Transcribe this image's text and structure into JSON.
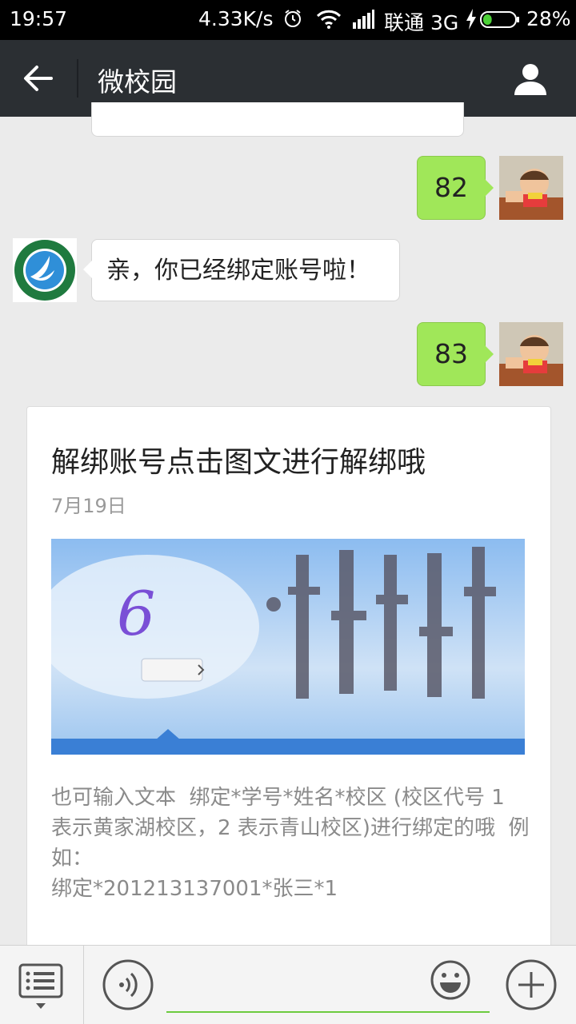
{
  "status_bar": {
    "time": "19:57",
    "net_speed": "4.33K/s",
    "carrier": "联通 3G",
    "battery": "28%",
    "battery_level": 0.28
  },
  "title_bar": {
    "title": "微校园",
    "icons": [
      "back-arrow-icon",
      "profile-icon"
    ]
  },
  "messages": [
    {
      "side": "right",
      "text": "82"
    },
    {
      "side": "left",
      "text": "亲，你已经绑定账号啦！"
    },
    {
      "side": "right",
      "text": "83"
    }
  ],
  "article": {
    "title": "解绑账号点击图文进行解绑哦",
    "date": "7月19日",
    "description": "也可输入文本  绑定*学号*姓名*校区 (校区代号 1 表示黄家湖校区，2 表示青山校区)进行绑定的哦  例如：\n绑定*201213137001*张三*1"
  },
  "input_bar": {
    "placeholder": "",
    "icons": [
      "menu-list-icon",
      "voice-icon",
      "emoji-icon",
      "plus-icon"
    ]
  },
  "colors": {
    "title_bar": "#2b2f33",
    "sent_bubble": "#a0e759",
    "background": "#ebebeb",
    "input_underline": "#6ccb3f"
  }
}
